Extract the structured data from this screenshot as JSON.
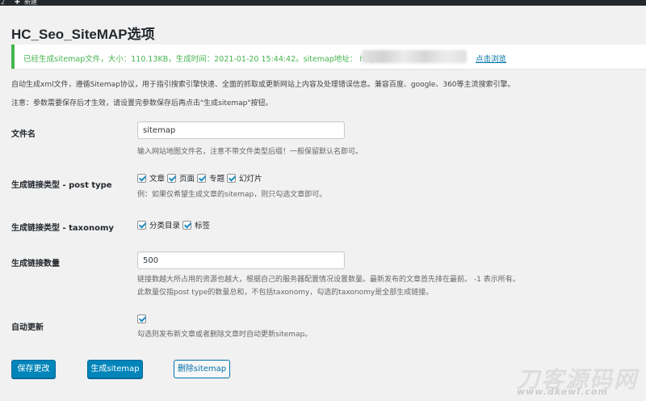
{
  "adminbar": {
    "number": "2",
    "plus_icon": "plus-icon",
    "new_label": "新建"
  },
  "page": {
    "title": "HC_Seo_SiteMAP选项"
  },
  "notice": {
    "text": "已经生成sitemap文件，大小：110.13KB，生成时间：2021-01-20 15:44:42。sitemap地址： http:",
    "link_label": "点击浏览",
    "color": "#46b450"
  },
  "intro": {
    "line1": "自动生成xml文件，遵循Sitemap协议，用于指引搜索引擎快速、全面的抓取或更新网站上内容及处理错误信息。兼容百度、google、360等主流搜索引擎。",
    "line2": "注意：参数需要保存后才生效，请设置完参数保存后再点击\"生成sitemap\"按钮。"
  },
  "fields": {
    "filename": {
      "label": "文件名",
      "value": "sitemap",
      "hint": "输入网站地图文件名，注意不带文件类型后缀！一般保留默认名即可。"
    },
    "post_type": {
      "label": "生成链接类型 - post type",
      "options": [
        {
          "label": "文章",
          "checked": true
        },
        {
          "label": "页面",
          "checked": true
        },
        {
          "label": "专题",
          "checked": true
        },
        {
          "label": "幻灯片",
          "checked": true
        }
      ],
      "hint": "例：如果仅希望生成文章的sitemap，则只勾选文章即可。"
    },
    "taxonomy": {
      "label": "生成链接类型 - taxonomy",
      "options": [
        {
          "label": "分类目录",
          "checked": true
        },
        {
          "label": "标签",
          "checked": true
        }
      ]
    },
    "count": {
      "label": "生成链接数量",
      "value": "500",
      "hint1": "链接数越大所占用的资源也越大，根据自己的服务器配置情况设置数量。最新发布的文章首先排在最前。 -1 表示所有。",
      "hint2": "此数量仅指post type的数量总和，不包括taxonomy，勾选的taxonomy是全部生成链接。"
    },
    "auto_update": {
      "label": "自动更新",
      "checked": true,
      "hint": "勾选则发布新文章或者删除文章时自动更新sitemap。"
    }
  },
  "buttons": {
    "save": "保存更改",
    "generate": "生成sitemap",
    "delete": "删除sitemap"
  },
  "watermark": {
    "big": "刀客源码网",
    "small": "www.dkewl.com"
  }
}
